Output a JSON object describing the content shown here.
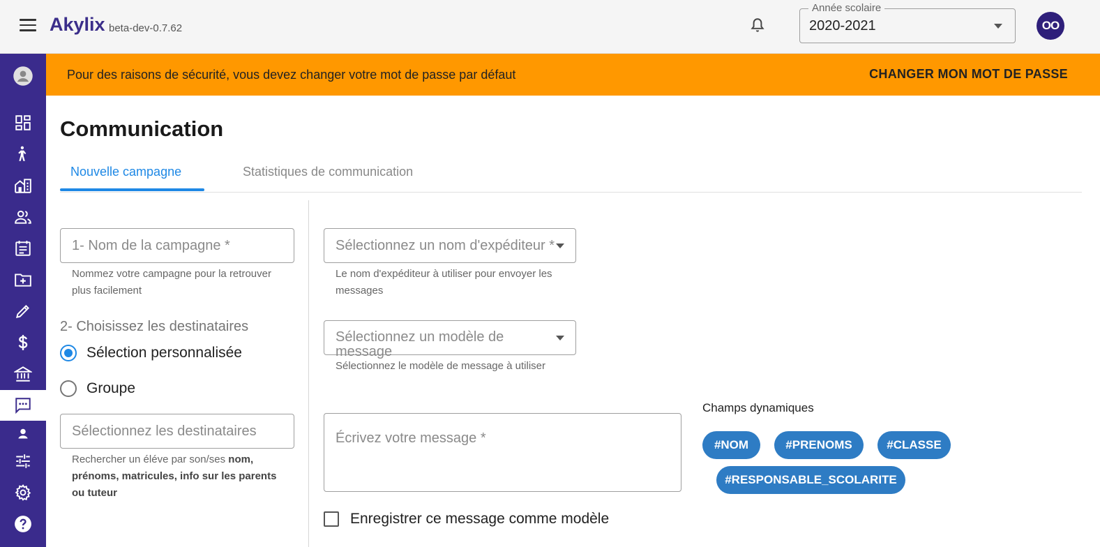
{
  "header": {
    "brand": "Akylix",
    "version": "beta-dev-0.7.62",
    "school_year": {
      "label": "Année scolaire",
      "value": "2020-2021"
    },
    "avatar_initials": "OO"
  },
  "sidebar": {
    "items": [
      {
        "icon": "account-circle-icon"
      },
      {
        "icon": "dashboard-icon"
      },
      {
        "icon": "student-icon"
      },
      {
        "icon": "building-icon"
      },
      {
        "icon": "people-icon"
      },
      {
        "icon": "calendar-note-icon"
      },
      {
        "icon": "folder-add-icon"
      },
      {
        "icon": "pencil-icon"
      },
      {
        "icon": "dollar-icon"
      },
      {
        "icon": "bank-icon"
      },
      {
        "icon": "message-icon",
        "active": true
      },
      {
        "icon": "person-small-icon"
      },
      {
        "icon": "sliders-icon"
      },
      {
        "icon": "gear-icon"
      },
      {
        "icon": "help-icon"
      }
    ]
  },
  "banner": {
    "text": "Pour des raisons de sécurité, vous devez changer votre mot de passe par défaut",
    "action": "CHANGER MON MOT DE PASSE",
    "color": "#ff9800"
  },
  "page": {
    "title": "Communication",
    "tabs": [
      {
        "label": "Nouvelle campagne",
        "active": true
      },
      {
        "label": "Statistiques de communication",
        "active": false
      }
    ]
  },
  "form": {
    "campaign_name": {
      "placeholder": "1- Nom de la campagne *",
      "hint": "Nommez votre campagne pour la retrouver plus facilement"
    },
    "recipients_title": "2- Choisissez les destinataires",
    "radio_custom": "Sélection personnalisée",
    "radio_group": "Groupe",
    "recipients_field": {
      "placeholder": "Sélectionnez les destinataires"
    },
    "recipients_hint_prefix": "Rechercher un éléve par son/ses ",
    "recipients_hint_bold": "nom, prénoms, matricules, info sur les parents ou tuteur",
    "sender": {
      "placeholder": "Sélectionnez un nom d'expéditeur *",
      "hint": "Le nom d'expéditeur à utiliser pour envoyer les messages"
    },
    "template": {
      "placeholder": "Sélectionnez un modèle de message",
      "hint": "Sélectionnez le modèle de message à utiliser"
    },
    "message": {
      "placeholder": "Écrivez votre message *"
    },
    "save_template": "Enregistrer ce message comme modèle"
  },
  "dynamic_fields": {
    "title": "Champs dynamiques",
    "chips": [
      "#NOM",
      "#PRENOMS",
      "#CLASSE",
      "#RESPONSABLE_SCOLARITE"
    ]
  },
  "colors": {
    "primary": "#3a2b8c",
    "accent": "#1e88e5",
    "chip": "#2e7cc4"
  }
}
